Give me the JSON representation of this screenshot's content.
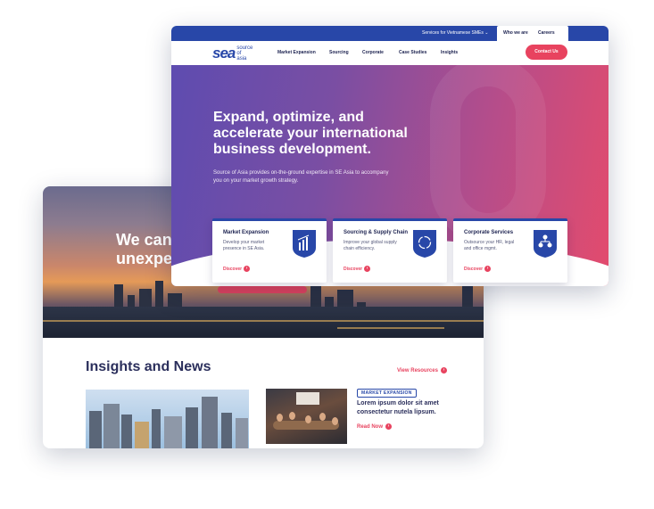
{
  "back_page": {
    "hero_text_line1": "We can",
    "hero_text_line2": "unexpe",
    "insights_title": "Insights and News",
    "view_resources": "View Resources",
    "article": {
      "badge": "MARKET EXPANSION",
      "title": "Lorem ipsum dolor sit amet consectetur nutela lipsum.",
      "read_now": "Read Now"
    }
  },
  "front_page": {
    "topbar": {
      "services": "Services for Vietnamese SMEs",
      "who_we_are": "Who we are",
      "careers": "Careers"
    },
    "logo": {
      "mark": "sea",
      "line1": "source",
      "line2": "of",
      "line3": "asia"
    },
    "nav": [
      "Market Expansion",
      "Sourcing",
      "Corporate",
      "Case Studies",
      "Insights"
    ],
    "contact": "Contact Us",
    "hero": {
      "headline": "Expand, optimize, and accelerate your international business development.",
      "subtext": "Source of Asia provides on-the-ground expertise in SE Asia to accompany you on your market growth strategy."
    },
    "services": [
      {
        "title": "Market Expansion",
        "desc": "Develop your market presence in SE Asia.",
        "link": "Discover",
        "icon": "bar-chart-icon"
      },
      {
        "title": "Sourcing & Supply Chain",
        "desc": "Improve your global supply chain efficiency.",
        "link": "Discover",
        "icon": "cycle-icon"
      },
      {
        "title": "Corporate Services",
        "desc": "Outsource your HR, legal and office mgmt.",
        "link": "Discover",
        "icon": "org-chart-icon"
      }
    ]
  },
  "colors": {
    "brand_blue": "#2847a8",
    "accent_pink": "#e8435f",
    "navy_text": "#1c2250"
  }
}
